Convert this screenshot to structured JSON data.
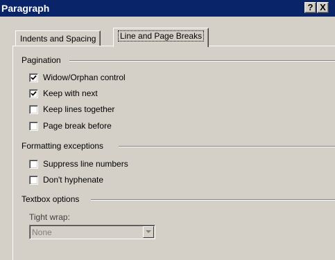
{
  "window": {
    "title": "Paragraph",
    "help_label": "?",
    "close_label": "X"
  },
  "tabs": [
    {
      "label": "Indents and Spacing",
      "active": false
    },
    {
      "label": "Line and Page Breaks",
      "active": true
    }
  ],
  "pagination": {
    "label": "Pagination",
    "options": [
      {
        "label": "Widow/Orphan control",
        "checked": true
      },
      {
        "label": "Keep with next",
        "checked": true
      },
      {
        "label": "Keep lines together",
        "checked": false
      },
      {
        "label": "Page break before",
        "checked": false
      }
    ]
  },
  "formatting_exceptions": {
    "label": "Formatting exceptions",
    "options": [
      {
        "label": "Suppress line numbers",
        "checked": false
      },
      {
        "label": "Don't hyphenate",
        "checked": false
      }
    ]
  },
  "textbox_options": {
    "label": "Textbox options",
    "tight_wrap_label": "Tight wrap:",
    "tight_wrap_value": "None"
  },
  "colors": {
    "titlebar": "#0a246a",
    "dialog_face": "#d4d0c8"
  }
}
